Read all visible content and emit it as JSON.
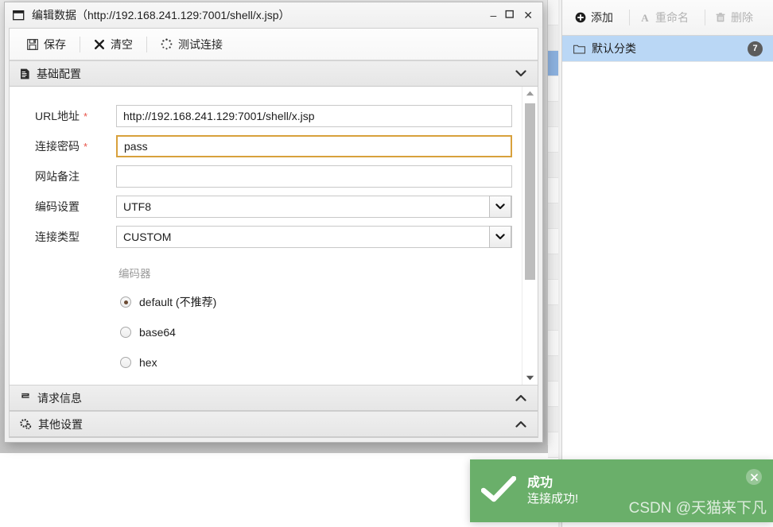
{
  "dialog": {
    "title": "编辑数据（http://192.168.241.129:7001/shell/x.jsp）",
    "window_icon": "window-restore-icon",
    "minimize": "–",
    "maximize": "▢",
    "close": "✕",
    "toolbar": [
      {
        "label": "保存",
        "icon": "save-icon"
      },
      {
        "label": "清空",
        "icon": "clear-x-icon"
      },
      {
        "label": "测试连接",
        "icon": "spinner-icon"
      }
    ],
    "sections": [
      {
        "key": "basic",
        "label": "基础配置",
        "icon": "document-icon",
        "chevron": "⌄",
        "expanded": true
      },
      {
        "key": "request",
        "label": "请求信息",
        "icon": "request-icon",
        "chevron": "⌃",
        "expanded": false
      },
      {
        "key": "other",
        "label": "其他设置",
        "icon": "gear-icon",
        "chevron": "⌃",
        "expanded": false
      }
    ],
    "form": {
      "fields": [
        {
          "label": "URL地址",
          "required": true,
          "value": "http://192.168.241.129:7001/shell/x.jsp",
          "type": "text",
          "focused": false
        },
        {
          "label": "连接密码",
          "required": true,
          "value": "pass",
          "type": "text",
          "focused": true
        },
        {
          "label": "网站备注",
          "required": false,
          "value": "",
          "type": "text",
          "focused": false
        },
        {
          "label": "编码设置",
          "required": false,
          "value": "UTF8",
          "type": "select",
          "focused": false
        },
        {
          "label": "连接类型",
          "required": false,
          "value": "CUSTOM",
          "type": "select",
          "focused": false
        }
      ],
      "encoder_group_label": "编码器",
      "encoder_options": [
        {
          "label": "default (不推荐)",
          "selected": true
        },
        {
          "label": "base64",
          "selected": false
        },
        {
          "label": "hex",
          "selected": false
        }
      ],
      "scrollbar": {
        "up_arrow": "▲",
        "down_arrow": "▼"
      }
    }
  },
  "right_panel": {
    "toolbar": [
      {
        "label": "添加",
        "icon": "plus-circle-icon",
        "disabled": false
      },
      {
        "label": "重命名",
        "icon": "rename-a-icon",
        "disabled": true
      },
      {
        "label": "删除",
        "icon": "trash-icon",
        "disabled": true
      }
    ],
    "categories": [
      {
        "label": "默认分类",
        "icon": "folder-icon",
        "count": "7",
        "selected": true
      }
    ]
  },
  "toast": {
    "icon": "check-icon",
    "title": "成功",
    "message": "连接成功!",
    "close": "✕"
  },
  "watermark": "CSDN @天猫来下凡",
  "colors": {
    "toast_green": "#6aaf6a",
    "selection_blue": "#bad7f5",
    "focus_amber": "#d8a13c",
    "required_red": "#e8544a",
    "badge_gray": "#5c5c5c"
  }
}
